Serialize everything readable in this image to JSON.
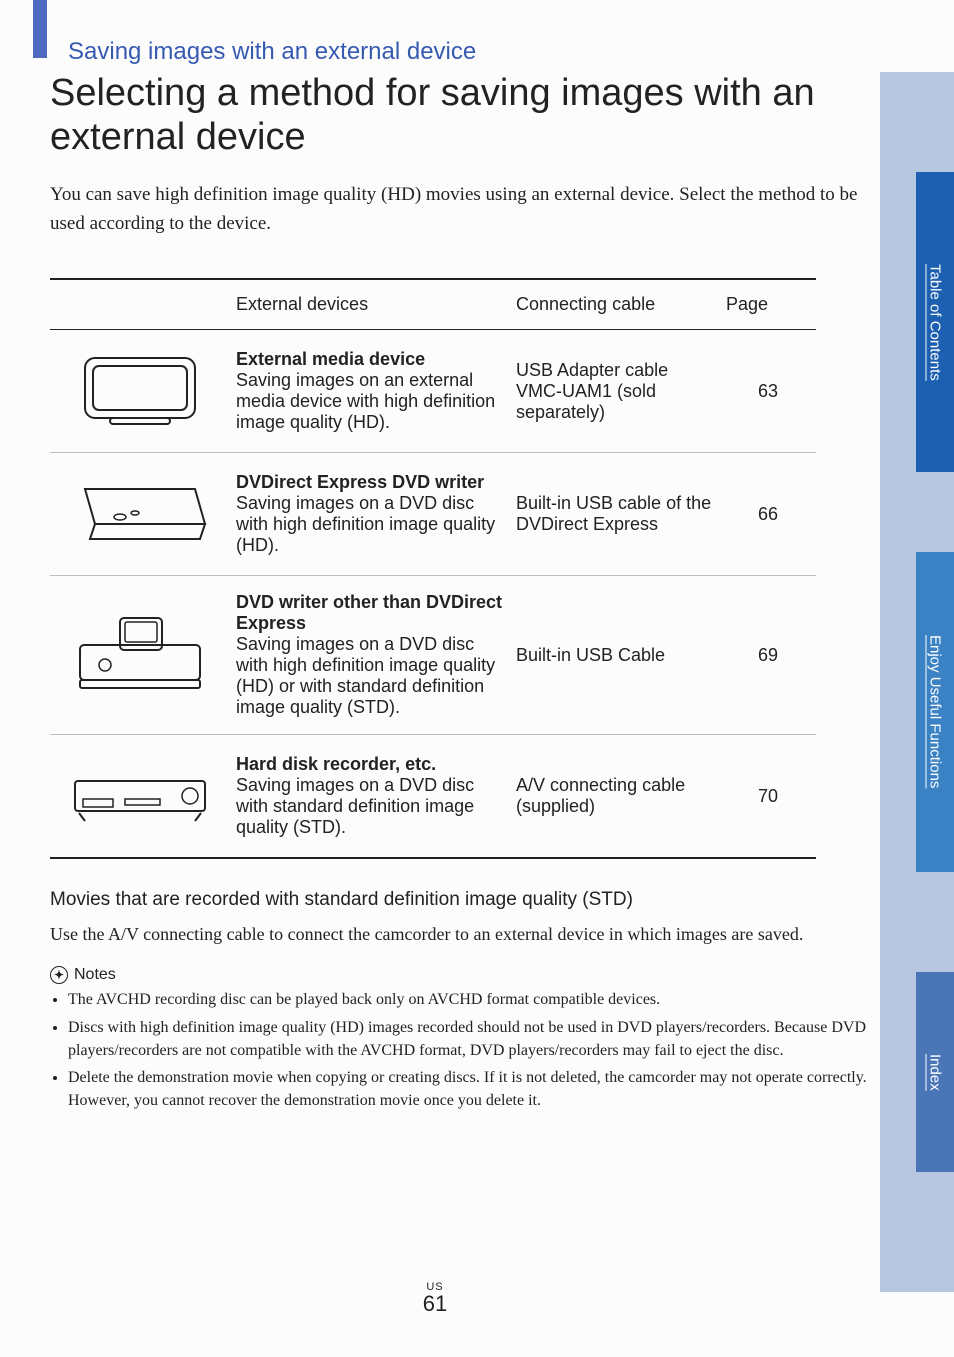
{
  "section_heading": "Saving images with an external device",
  "page_title": "Selecting a method for saving images with an external device",
  "intro": "You can save high definition image quality (HD) movies using an external device. Select the method to be used according to the device.",
  "table": {
    "headers": {
      "devices": "External devices",
      "cable": "Connecting cable",
      "page": "Page"
    },
    "rows": [
      {
        "icon": "external-hdd-icon",
        "title": "External media device",
        "desc": "Saving images on an external media device with high definition image quality (HD).",
        "cable": "USB Adapter cable VMC-UAM1 (sold separately)",
        "page": "63"
      },
      {
        "icon": "dvd-express-icon",
        "title": "DVDirect Express DVD writer",
        "desc": "Saving images on a DVD disc with high definition image quality (HD).",
        "cable": "Built-in USB cable of the DVDirect Express",
        "page": "66"
      },
      {
        "icon": "dvd-writer-icon",
        "title": "DVD writer other than DVDirect Express",
        "desc": "Saving images on a DVD disc with high definition image quality (HD) or with standard definition image quality (STD).",
        "cable": "Built-in USB Cable",
        "page": "69"
      },
      {
        "icon": "hdd-recorder-icon",
        "title": "Hard disk recorder, etc.",
        "desc": "Saving images on a DVD disc with standard definition image quality (STD).",
        "cable": "A/V connecting cable (supplied)",
        "page": "70"
      }
    ]
  },
  "subheading": "Movies that are recorded with standard definition image quality (STD)",
  "sub_body": "Use the A/V connecting cable to connect the camcorder to an external device in which images are saved.",
  "notes_label": "Notes",
  "notes": [
    "The AVCHD recording disc can be played back only on AVCHD format compatible devices.",
    "Discs with high definition image quality (HD) images recorded should not be used in DVD players/recorders. Because DVD players/recorders are not compatible with the AVCHD format, DVD players/recorders may fail to eject the disc.",
    "Delete the demonstration movie when copying or creating discs. If it is not deleted, the camcorder may not operate correctly. However, you cannot recover the demonstration movie once you delete it."
  ],
  "page_region": "US",
  "page_number": "61",
  "tabs": {
    "toc": "Table of Contents",
    "useful": "Enjoy Useful Functions",
    "index": "Index"
  }
}
